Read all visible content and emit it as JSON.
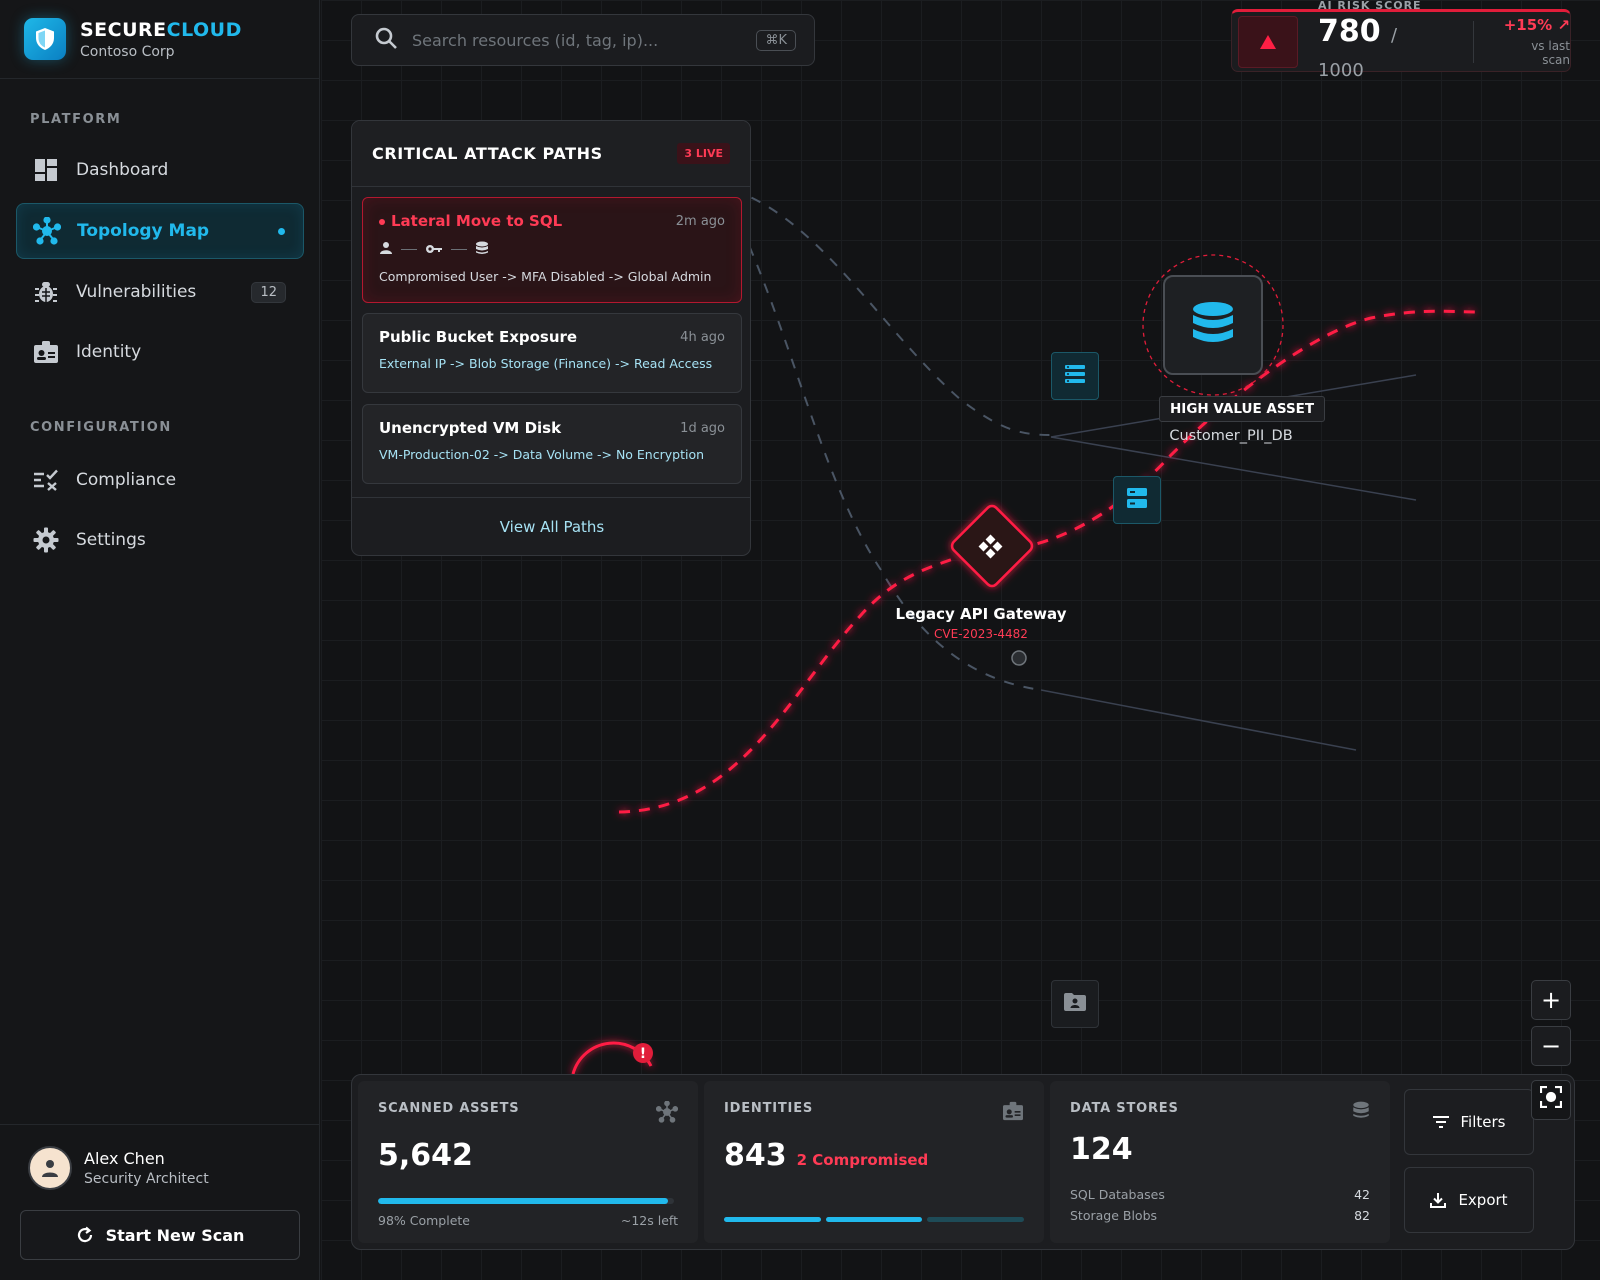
{
  "brand": {
    "name_prefix": "SECURE",
    "name_accent": "CLOUD",
    "org": "Contoso Corp"
  },
  "nav": {
    "platform_label": "PLATFORM",
    "config_label": "CONFIGURATION",
    "items": [
      {
        "label": "Dashboard",
        "icon": "grid-icon"
      },
      {
        "label": "Topology Map",
        "icon": "network-icon",
        "active": true
      },
      {
        "label": "Vulnerabilities",
        "icon": "bug-icon",
        "count": "12"
      },
      {
        "label": "Identity",
        "icon": "id-badge-icon"
      },
      {
        "label": "Compliance",
        "icon": "checklist-icon"
      },
      {
        "label": "Settings",
        "icon": "gear-icon"
      }
    ]
  },
  "user": {
    "name": "Alex Chen",
    "role": "Security Architect"
  },
  "scan_button": "Start New Scan",
  "search": {
    "placeholder": "Search resources (id, tag, ip)...",
    "shortcut": "⌘K"
  },
  "risk": {
    "label": "AI RISK SCORE",
    "value": "780",
    "max": "/ 1000",
    "change": "+15%",
    "sub": "vs last scan"
  },
  "attack_paths": {
    "title": "CRITICAL ATTACK PATHS",
    "badge": "3 LIVE",
    "items": [
      {
        "title": "Lateral Move to SQL",
        "time": "2m ago",
        "chain": "Compromised User -> MFA Disabled -> Global Admin",
        "critical": true
      },
      {
        "title": "Public Bucket Exposure",
        "time": "4h ago",
        "chain": "External IP -> Blob Storage (Finance) -> Read Access"
      },
      {
        "title": "Unencrypted VM Disk",
        "time": "1d ago",
        "chain": "VM-Production-02 -> Data Volume -> No Encryption"
      }
    ],
    "footer": "View All Paths"
  },
  "nodes": {
    "hva_tag": "HIGH VALUE ASSET",
    "hva_name": "Customer_PII_DB",
    "gateway_name": "Legacy API Gateway",
    "gateway_cve": "CVE-2023-4482"
  },
  "zoom": {
    "in": "+",
    "out": "−"
  },
  "stats": {
    "scanned": {
      "label": "SCANNED ASSETS",
      "value": "5,642",
      "progress_pct": 98,
      "complete": "98% Complete",
      "left": "~12s left"
    },
    "identities": {
      "label": "IDENTITIES",
      "value": "843",
      "compromised": "2 Compromised"
    },
    "datastores": {
      "label": "DATA STORES",
      "value": "124",
      "rows": [
        {
          "name": "SQL Databases",
          "count": "42"
        },
        {
          "name": "Storage Blobs",
          "count": "82"
        }
      ]
    },
    "filters": "Filters",
    "export": "Export"
  },
  "colors": {
    "accent": "#21b9ec",
    "danger": "#e11d3a",
    "panel": "#1c1d20"
  }
}
